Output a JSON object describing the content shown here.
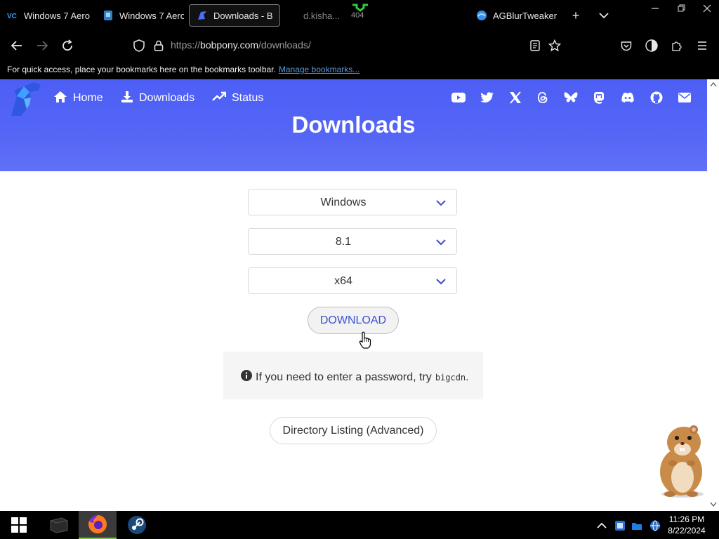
{
  "browser": {
    "tabs": [
      {
        "label": "Windows 7 Aero",
        "favicon": "vc-icon"
      },
      {
        "label": "Windows 7 Aero",
        "favicon": "shield-bookmark-icon"
      },
      {
        "label": "Downloads - B",
        "favicon": "bobpony-logo-icon",
        "active": true
      },
      {
        "label": "d.kisha...",
        "sub": "404",
        "favicon": "none"
      },
      {
        "label": "AGBlurTweaker",
        "favicon": "edge-icon"
      }
    ],
    "url_prefix": "https://",
    "url_host": "bobpony.com",
    "url_path": "/downloads/",
    "bookmarks_message": "For quick access, place your bookmarks here on the bookmarks toolbar.",
    "bookmarks_link": "Manage bookmarks..."
  },
  "site": {
    "nav": {
      "home": "Home",
      "downloads": "Downloads",
      "status": "Status"
    },
    "social_icons": [
      "youtube-icon",
      "twitter-icon",
      "x-icon",
      "threads-icon",
      "bluesky-icon",
      "mastodon-icon",
      "discord-icon",
      "github-icon",
      "mail-icon"
    ],
    "title": "Downloads",
    "selects": {
      "os": "Windows",
      "version": "8.1",
      "arch": "x64"
    },
    "download_button": "DOWNLOAD",
    "notice": {
      "text": "If you need to enter a password, try",
      "code": "bigcdn",
      "end": "."
    },
    "directory_button": "Directory Listing (Advanced)",
    "accent": "#4d5ef5"
  },
  "taskbar": {
    "time": "11:26 PM",
    "date": "8/22/2024"
  }
}
